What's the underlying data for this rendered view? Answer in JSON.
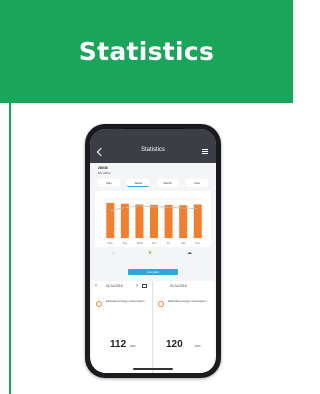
{
  "page": {
    "title": "Statistics"
  },
  "colors": {
    "accent": "#1ba55a",
    "app_bar": "#3b3f45",
    "button": "#2fa7d9",
    "bar": "#f08030"
  },
  "phone": {
    "app_bar": {
      "title": "Statistics"
    },
    "site": {
      "id": "26040",
      "name": "My Office"
    },
    "tabs": [
      {
        "label": "Day"
      },
      {
        "label": "Week"
      },
      {
        "label": "Month"
      },
      {
        "label": "Year"
      }
    ],
    "active_tab": "Week",
    "indicators": [
      {
        "icon": "thermometer-icon",
        "label": "↓"
      },
      {
        "icon": "leaf-icon",
        "label": "❦"
      },
      {
        "icon": "cloud-icon",
        "label": "☁"
      }
    ],
    "compare_button": {
      "label": "Compare"
    },
    "compare": [
      {
        "date": "16 Jul 2018",
        "label": "Estimated energy consumption",
        "value": "112",
        "unit": "kWh"
      },
      {
        "date": "23 Jul 2018",
        "label": "Estimated energy consumption",
        "value": "120",
        "unit": "kWh"
      }
    ]
  },
  "chart_data": {
    "type": "bar",
    "categories": [
      "Mon",
      "Tue",
      "Wed",
      "Thu",
      "Fri",
      "Sat",
      "Sun"
    ],
    "series": [
      {
        "values": [
          0.9,
          0.88,
          0.86,
          0.85,
          0.85,
          0.84,
          0.86
        ]
      }
    ],
    "line_values": [
      0.7,
      0.78,
      0.82,
      0.8,
      0.79,
      0.77,
      0.76
    ],
    "ylim": [
      0,
      1
    ],
    "legend": "top-right",
    "grid": true
  }
}
